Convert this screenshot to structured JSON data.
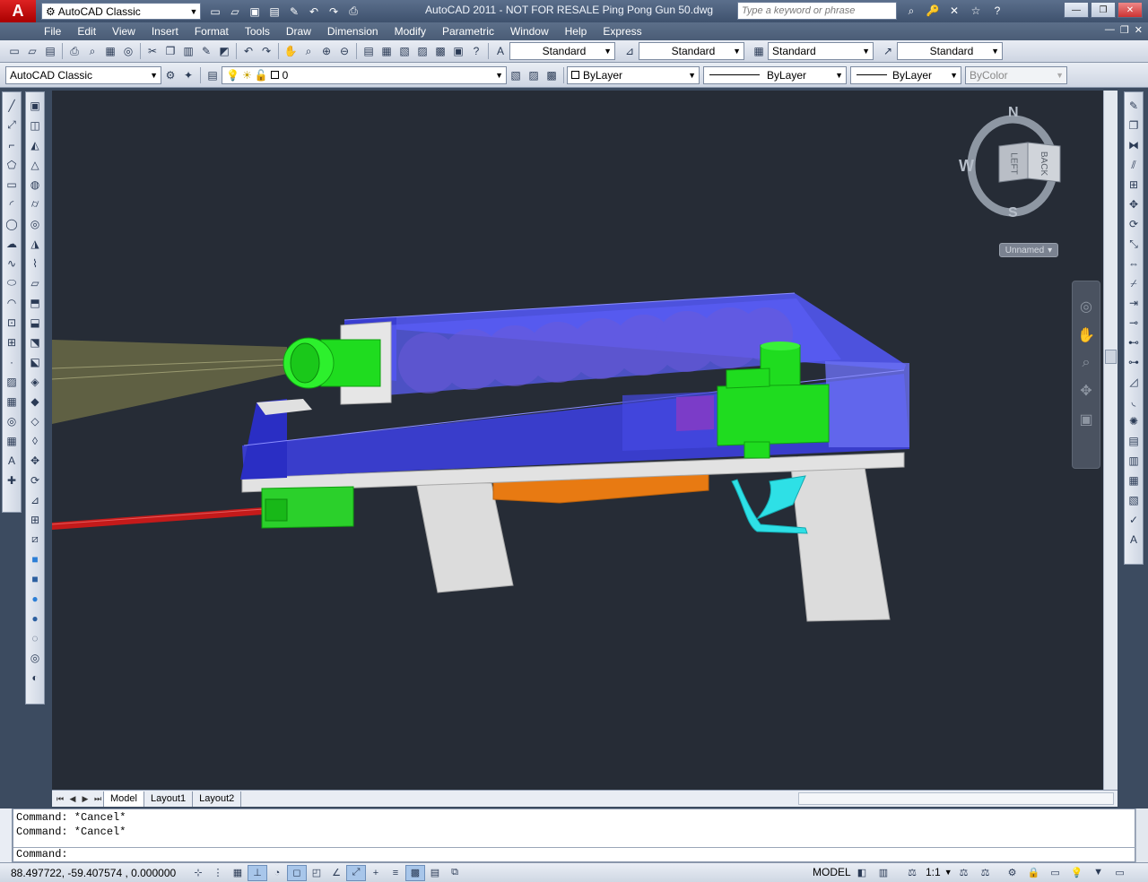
{
  "titlebar": {
    "workspace": "AutoCAD Classic",
    "title": "AutoCAD 2011 - NOT FOR RESALE    Ping Pong Gun 50.dwg",
    "search_placeholder": "Type a keyword or phrase"
  },
  "menu": [
    "File",
    "Edit",
    "View",
    "Insert",
    "Format",
    "Tools",
    "Draw",
    "Dimension",
    "Modify",
    "Parametric",
    "Window",
    "Help",
    "Express"
  ],
  "styles_toolbar": {
    "text_style": "Standard",
    "dim_style": "Standard",
    "table_style": "Standard",
    "mleader_style": "Standard"
  },
  "layers_toolbar": {
    "workspace": "AutoCAD Classic",
    "current_layer": "0",
    "color": "ByLayer",
    "linetype": "ByLayer",
    "lineweight": "ByLayer",
    "plotstyle": "ByColor"
  },
  "viewcube": {
    "north": "N",
    "south": "S",
    "west": "W",
    "face_left": "LEFT",
    "face_back": "BACK",
    "ucs_menu": "Unnamed"
  },
  "layout_tabs": [
    "Model",
    "Layout1",
    "Layout2"
  ],
  "active_tab": "Model",
  "command_history": [
    "Command:  *Cancel*",
    "Command:  *Cancel*"
  ],
  "command_prompt": "Command:",
  "status": {
    "coordinates": "88.497722,  -59.407574 , 0.000000",
    "space": "MODEL",
    "annotation_scale": "1:1"
  },
  "colors": {
    "viewport_bg": "#262c36",
    "barrel_blue": "#3b3fd8",
    "tube_green": "#1fdc1f",
    "magazine_orange": "#e87a12",
    "trigger_cyan": "#2ee0e6",
    "laser_red": "#c41a1a",
    "grip_gray": "#dcdcdc"
  }
}
